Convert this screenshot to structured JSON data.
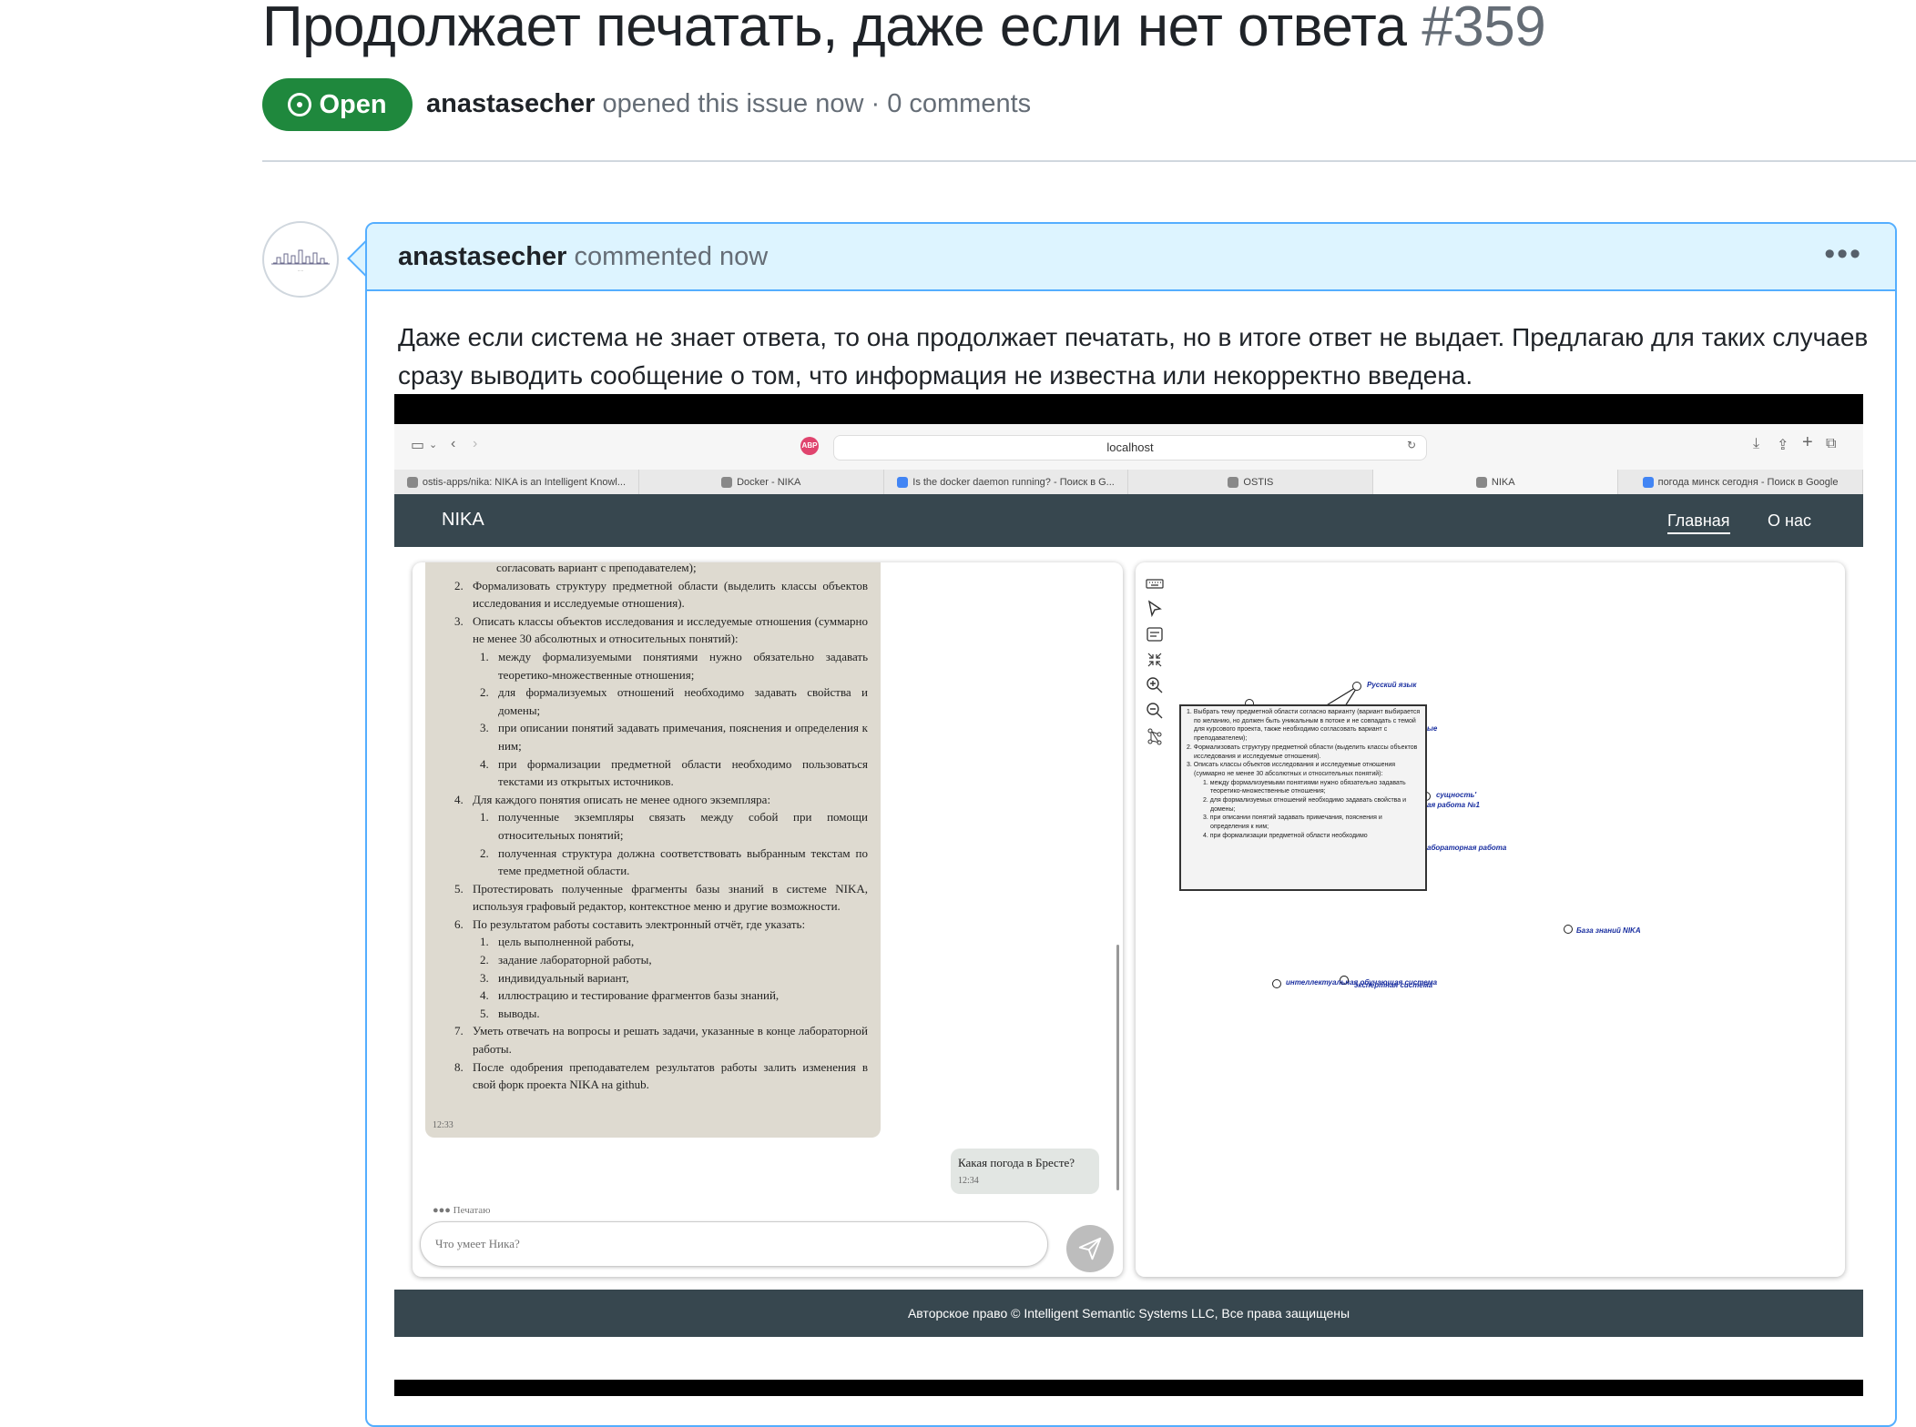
{
  "issue": {
    "title": "Продолжает печатать, даже если нет ответа",
    "number": "#359",
    "state": "Open",
    "author": "anastasecher",
    "meta_text": "opened this issue now · 0 comments"
  },
  "comment": {
    "author": "anastasecher",
    "action": "commented now",
    "menu": "•••",
    "body": "Даже если система не знает ответа, то она продолжает печатать, но в итоге ответ не выдает. Предлагаю для таких случаев сразу выводить сообщение о том, что информация не известна или некорректно введена."
  },
  "screenshot": {
    "browser": {
      "url": "localhost",
      "tabs": [
        "ostis-apps/nika: NIKA is an Intelligent Knowl...",
        "Docker - NIKA",
        "Is the docker daemon running? - Поиск в G...",
        "OSTIS",
        "NIKA",
        "погода минск сегодня - Поиск в Google"
      ]
    },
    "nav": {
      "brand": "NIKA",
      "links": [
        "Главная",
        "О нас"
      ]
    },
    "chat": {
      "bot_head": "согласовать вариант с преподавателем);",
      "bot_items": [
        {
          "n": "2.",
          "text": "Формализовать структуру предметной области (выделить классы объектов исследования и исследуемые отношения)."
        },
        {
          "n": "3.",
          "text": "Описать классы объектов исследования и исследуемые отношения (суммарно не менее 30 абсолютных и относительных понятий):"
        },
        {
          "n": "1.",
          "text": "между формализуемыми понятиями нужно обязательно задавать теоретико-множественные отношения;"
        },
        {
          "n": "2.",
          "text": "для формализуемых отношений необходимо задавать свойства и домены;"
        },
        {
          "n": "3.",
          "text": "при описании понятий задавать примечания, пояснения и определения к ним;"
        },
        {
          "n": "4.",
          "text": "при формализации предметной области необходимо пользоваться текстами из открытых источников."
        },
        {
          "n": "4.",
          "text": "Для каждого понятия описать не менее одного экземпляра:"
        },
        {
          "n": "1.",
          "text": "полученные экземпляры связать между собой при помощи относительных понятий;"
        },
        {
          "n": "2.",
          "text": "полученная структура должна соответствовать выбранным текстам по теме предметной области."
        },
        {
          "n": "5.",
          "text": "Протестировать полученные фрагменты базы знаний в системе NIKA, используя графовый редактор, контекстное меню и другие возможности."
        },
        {
          "n": "6.",
          "text": "По результатом работы составить электронный отчёт, где указать:"
        },
        {
          "n": "1.",
          "text": "цель выполненной работы,"
        },
        {
          "n": "2.",
          "text": "задание лабораторной работы,"
        },
        {
          "n": "3.",
          "text": "индивидуальный вариант,"
        },
        {
          "n": "4.",
          "text": "иллюстрацию и тестирование фрагментов базы знаний,"
        },
        {
          "n": "5.",
          "text": "выводы."
        },
        {
          "n": "7.",
          "text": "Уметь отвечать на вопросы и решать задачи, указанные в конце лабораторной работы."
        },
        {
          "n": "8.",
          "text": "После одобрения преподавателем результатов работы залить изменения в свой форк проекта NIKA на github."
        }
      ],
      "bot_time": "12:33",
      "user_message": "Какая погода в Бресте?",
      "user_time": "12:34",
      "typing": "●●● Печатаю",
      "input_placeholder": "Что умеет Ника?"
    },
    "graph": {
      "nodes": [
        "Русский язык",
        "ые",
        "сущность'",
        "ая работа №1",
        "абораторная работа",
        "База знаний NIKA",
        "интеллектуальная обучающая система",
        "экспертная система"
      ],
      "popup_items": [
        "1. Выбрать тему предметной области согласно варианту (вариант выбирается по желанию, но должен быть уникальным в потоке и не совпадать с темой для курсового проекта, также необходимо согласовать вариант с преподавателем);",
        "2. Формализовать структуру предметной области (выделить классы объектов исследования и исследуемые отношения).",
        "3. Описать классы объектов исследования и исследуемые отношения (суммарно не менее 30 абсолютных и относительных понятий):",
        "1. между формализуемыми понятиями нужно обязательно задавать теоретико-множественные отношения;",
        "2. для формализуемых отношений необходимо задавать свойства и домены;",
        "3. при описании понятий задавать примечания, пояснения и определения к ним;",
        "4. при формализации предметной области необходимо"
      ]
    },
    "footer": "Авторское право © Intelligent Semantic Systems LLC, Все права защищены"
  },
  "colors": {
    "open_green": "#1f883d",
    "comment_header_bg": "#ddf4ff",
    "comment_border": "#54aeff",
    "navbar_bg": "#37474f",
    "bot_bubble": "#dedad0",
    "graph_label": "#1a2fa0"
  }
}
